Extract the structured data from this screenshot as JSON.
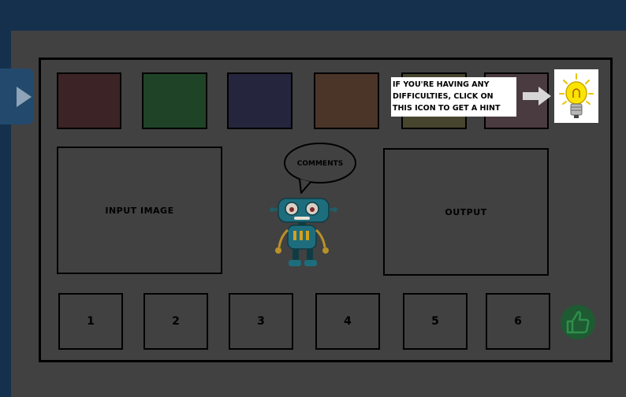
{
  "hint": {
    "text": "IF YOU'RE HAVING ANY\nDIFFICULTIES, CLICK ON\nTHIS ICON TO GET A HINT",
    "icon": "lightbulb-icon"
  },
  "swatches": [
    {
      "name": "red",
      "color": "#3c2326"
    },
    {
      "name": "green",
      "color": "#1f4326"
    },
    {
      "name": "blue",
      "color": "#25263e"
    },
    {
      "name": "brown",
      "color": "#4b3528"
    },
    {
      "name": "olive",
      "color": "#48452f"
    },
    {
      "name": "mauve",
      "color": "#4a3b40"
    }
  ],
  "panels": {
    "input_label": "INPUT IMAGE",
    "output_label": "OUTPUT",
    "comments_label": "COMMENTS"
  },
  "numbers": [
    "1",
    "2",
    "3",
    "4",
    "5",
    "6"
  ],
  "colors": {
    "header": "#15304d",
    "stage": "#414141",
    "side_tab": "#234a6d",
    "thumbs": "#1e5a32"
  },
  "icons": {
    "side_tab": "play-icon",
    "arrow": "right-arrow-icon",
    "robot": "robot-icon",
    "thumbs": "thumbs-up-icon"
  }
}
